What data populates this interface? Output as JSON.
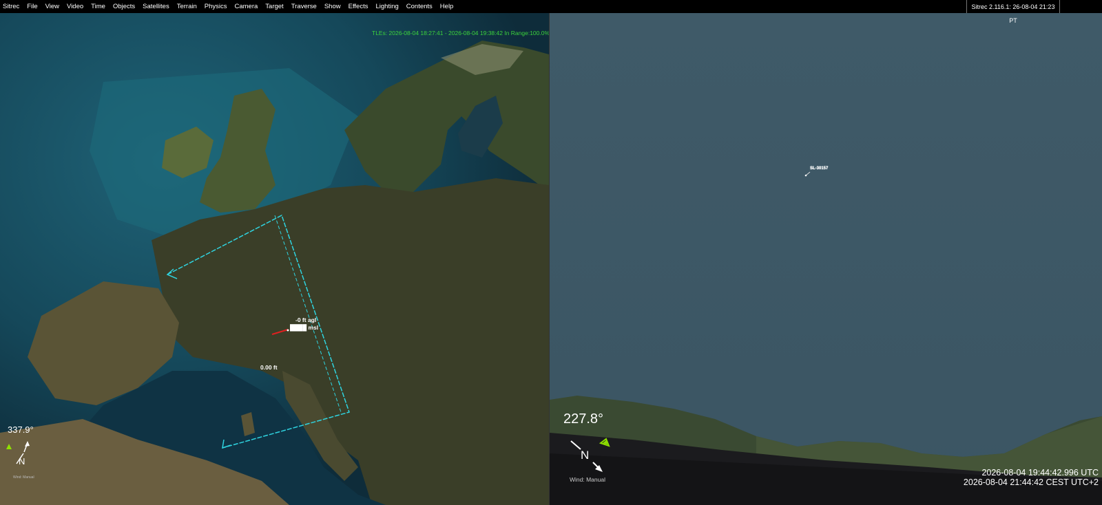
{
  "menubar": {
    "items": [
      "Sitrec",
      "File",
      "View",
      "Video",
      "Time",
      "Objects",
      "Satellites",
      "Terrain",
      "Physics",
      "Camera",
      "Target",
      "Traverse",
      "Show",
      "Effects",
      "Lighting",
      "Contents",
      "Help"
    ],
    "version": "Sitrec 2.116.1: 26-08-04 21:23 PT"
  },
  "left_view": {
    "tle_info": "TLEs: 2026-08-04 18:27:41 - 2026-08-04 19:38:42   In Range:100.0%",
    "agl_label": "-0 ft agl",
    "msl_label": "████ msl",
    "distance_label": "0.00 ft",
    "heading": "337.9°",
    "compass_letter": "N",
    "wind_label": "Wind: Manual"
  },
  "right_view": {
    "heading": "227.8°",
    "compass_letter": "N",
    "wind_label": "Wind: Manual",
    "time_utc": "2026-08-04 19:44:42.996 UTC",
    "time_local": "2026-08-04 21:44:42 CEST UTC+2",
    "satellite_label": "SL-30157"
  },
  "colors": {
    "track": "#2fd4e0",
    "tle_text": "#3cd43c",
    "sky": "#3d5866",
    "accent_green": "#8fe000"
  }
}
